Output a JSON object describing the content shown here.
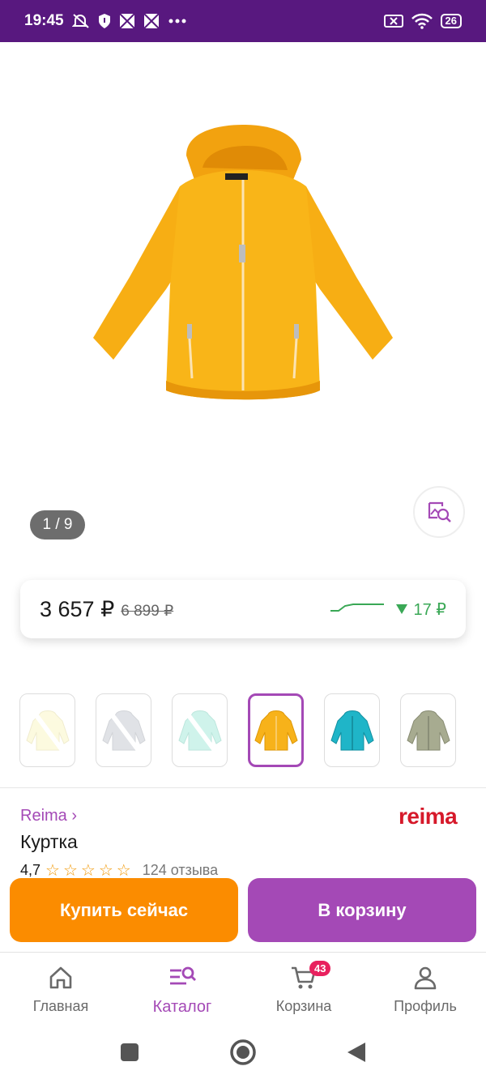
{
  "status_bar": {
    "time": "19:45",
    "left_icons": [
      "mute-icon",
      "shield-icon",
      "app-icon",
      "app-icon",
      "more-icon"
    ],
    "battery": "26"
  },
  "gallery": {
    "counter": "1 / 9"
  },
  "price": {
    "current": "3 657 ₽",
    "old": "6 899 ₽",
    "drop": "17 ₽",
    "drop_color": "#3aa856"
  },
  "colors": [
    {
      "name": "light-yellow",
      "swatch": "#fbf6c6",
      "available": false,
      "selected": false
    },
    {
      "name": "grey",
      "swatch": "#c7cbd3",
      "available": false,
      "selected": false
    },
    {
      "name": "mint",
      "swatch": "#a8eadb",
      "available": false,
      "selected": false
    },
    {
      "name": "yellow",
      "swatch": "#f7b21a",
      "available": true,
      "selected": true
    },
    {
      "name": "turquoise",
      "swatch": "#1fb5c8",
      "available": true,
      "selected": false
    },
    {
      "name": "khaki",
      "swatch": "#a7ab90",
      "available": true,
      "selected": false
    }
  ],
  "product": {
    "brand_link": "Reima ›",
    "brand_logo": "reima",
    "title": "Куртка",
    "rating": "4,7",
    "reviews": "124 отзыва"
  },
  "actions": {
    "buy_now": "Купить сейчас",
    "add_to_cart": "В корзину"
  },
  "nav": {
    "items": [
      {
        "label": "Главная",
        "icon": "home-icon"
      },
      {
        "label": "Каталог",
        "icon": "catalog-search-icon"
      },
      {
        "label": "Корзина",
        "icon": "cart-icon"
      },
      {
        "label": "Профиль",
        "icon": "profile-icon"
      }
    ],
    "cart_badge": "43"
  },
  "theme": {
    "accent": "#a449b6",
    "buy_button": "#fb8c00",
    "status_bar": "#58187f",
    "brand_logo_color": "#d6192a"
  }
}
